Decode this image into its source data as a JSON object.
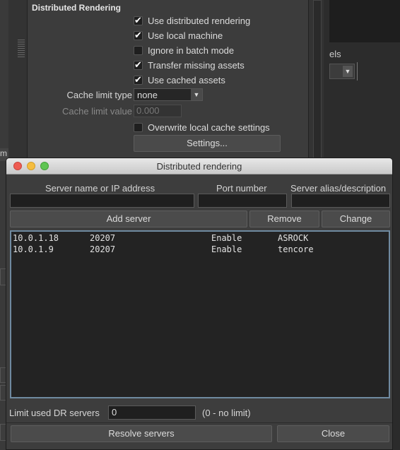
{
  "background": {
    "side_tab": "m",
    "panel": {
      "title": "Distributed Rendering",
      "checkboxes": [
        {
          "label": "Use distributed rendering",
          "checked": true
        },
        {
          "label": "Use local machine",
          "checked": true
        },
        {
          "label": "Ignore in batch mode",
          "checked": false
        },
        {
          "label": "Transfer missing assets",
          "checked": true
        },
        {
          "label": "Use cached assets",
          "checked": true
        }
      ],
      "cache_limit_type_label": "Cache limit type",
      "cache_limit_type_value": "none",
      "cache_limit_value_label": "Cache limit value",
      "cache_limit_value": "0.000",
      "overwrite_label": "Overwrite local cache settings",
      "overwrite_checked": false,
      "settings_button": "Settings..."
    },
    "right_label": "els"
  },
  "dialog": {
    "title": "Distributed rendering",
    "columns": {
      "server": "Server name or IP address",
      "port": "Port number",
      "alias": "Server alias/description"
    },
    "inputs": {
      "server": "",
      "port": "",
      "alias": ""
    },
    "buttons": {
      "add": "Add server",
      "remove": "Remove",
      "change": "Change"
    },
    "servers": [
      {
        "ip": "10.0.1.18",
        "port": "20207",
        "status": "Enable",
        "alias": "ASROCK"
      },
      {
        "ip": "10.0.1.9",
        "port": "20207",
        "status": "Enable",
        "alias": "tencore"
      }
    ],
    "limit_label": "Limit used DR servers",
    "limit_value": "0",
    "limit_hint": "(0 - no limit)",
    "resolve_button": "Resolve servers",
    "close_button": "Close"
  }
}
